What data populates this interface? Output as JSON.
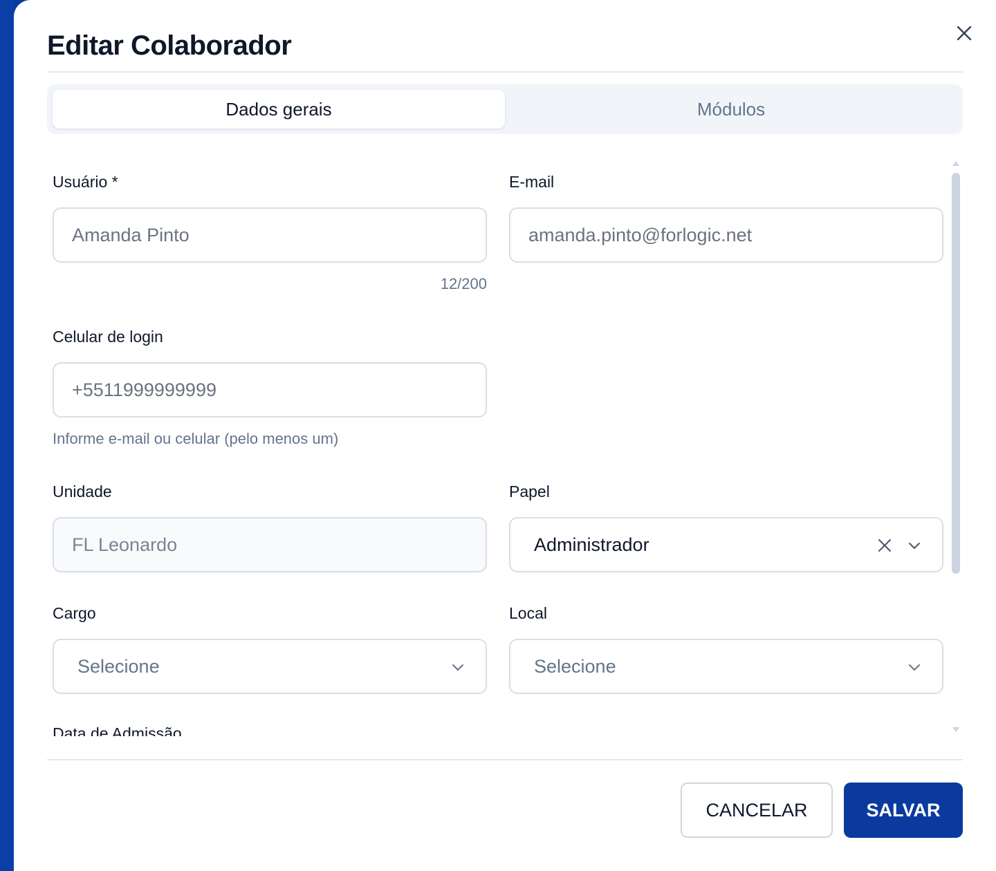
{
  "dialog": {
    "title": "Editar Colaborador",
    "close_icon": "close-icon"
  },
  "tabs": [
    {
      "label": "Dados gerais",
      "active": true
    },
    {
      "label": "Módulos",
      "active": false
    }
  ],
  "form": {
    "usuario": {
      "label": "Usuário *",
      "value": "Amanda Pinto",
      "counter": "12/200"
    },
    "email": {
      "label": "E-mail",
      "value": "amanda.pinto@forlogic.net"
    },
    "celular": {
      "label": "Celular de login",
      "value": "+5511999999999",
      "hint": "Informe e-mail ou celular (pelo menos um)"
    },
    "unidade": {
      "label": "Unidade",
      "value": "FL Leonardo",
      "disabled": true
    },
    "papel": {
      "label": "Papel",
      "value": "Administrador"
    },
    "cargo": {
      "label": "Cargo",
      "placeholder": "Selecione"
    },
    "local": {
      "label": "Local",
      "placeholder": "Selecione"
    },
    "data_admissao": {
      "label": "Data de Admissão"
    }
  },
  "footer": {
    "cancel_label": "CANCELAR",
    "save_label": "SALVAR"
  },
  "colors": {
    "primary": "#0a3a9e",
    "border": "#d8dee8",
    "muted_text": "#64748b"
  }
}
